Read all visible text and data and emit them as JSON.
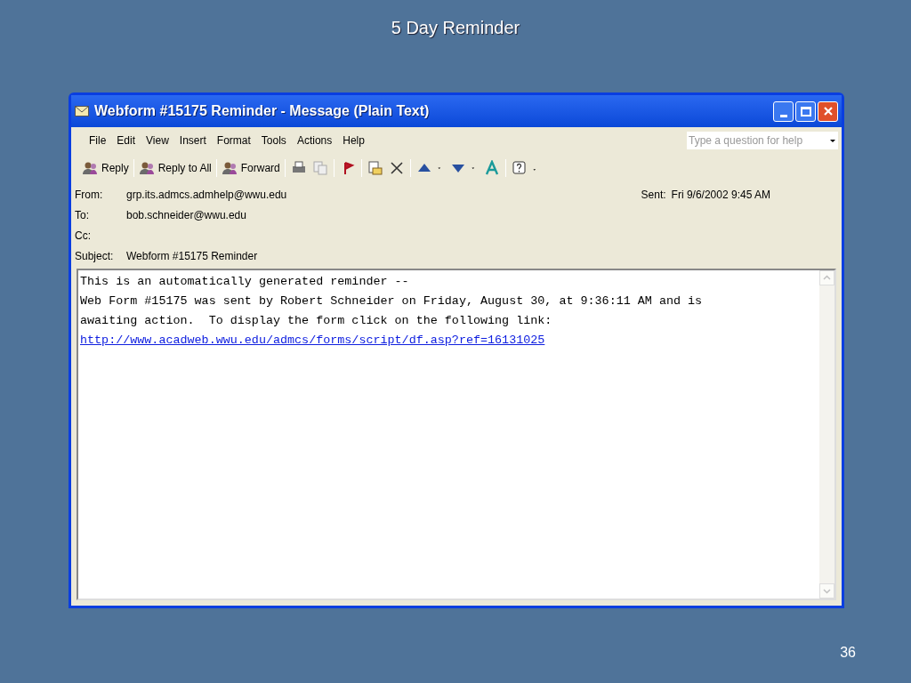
{
  "slide": {
    "title": "5 Day Reminder",
    "page_number": "36"
  },
  "window": {
    "title": "Webform #15175 Reminder - Message (Plain Text)"
  },
  "menu": [
    "File",
    "Edit",
    "View",
    "Insert",
    "Format",
    "Tools",
    "Actions",
    "Help"
  ],
  "help_search": {
    "placeholder": "Type a question for help"
  },
  "toolbar": [
    "Reply",
    "Reply to All",
    "Forward"
  ],
  "header": {
    "from_label": "From:",
    "from": "grp.its.admcs.admhelp@wwu.edu",
    "sent_label": "Sent:",
    "sent": "Fri 9/6/2002 9:45 AM",
    "to_label": "To:",
    "to": "bob.schneider@wwu.edu",
    "cc_label": "Cc:",
    "subject_label": "Subject:",
    "subject": "Webform #15175 Reminder"
  },
  "body": {
    "lines": [
      "This is an automatically generated reminder --",
      "Web Form #15175 was sent by Robert Schneider on Friday, August 30, at 9:36:11 AM and is",
      "awaiting action.  To display the form click on the following link:"
    ],
    "link": "http://www.acadweb.wwu.edu/admcs/forms/script/df.asp?ref=16131025"
  }
}
